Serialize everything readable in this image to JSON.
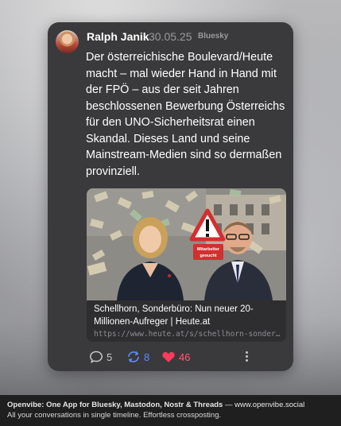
{
  "post": {
    "author": "Ralph Janik",
    "date": "30.05.25",
    "network": "Bluesky",
    "text": "Der österreichische Boulevard/Heute macht – mal wieder Hand in Hand mit der FPÖ – aus der seit Jahren beschlossenen Bewerbung Österreichs für den UNO-Sicherheitsrat einen Skandal. Dieses Land und seine Mainstream-Medien sind so dermaßen provinziell."
  },
  "link_card": {
    "title": "Schellhorn, Sonderbüro: Nun neuer 20-Millionen-Aufreger | Heute.at",
    "url": "https://www.heute.at/s/schellhorn-sonderbuero",
    "sign_text_1": "Mitarbeiter",
    "sign_text_2": "gesucht"
  },
  "actions": {
    "replies": "5",
    "reposts": "8",
    "likes": "46"
  },
  "footer": {
    "app_name": "Openvibe: One App for Bluesky, Mastodon, Nostr & Threads",
    "separator": " — ",
    "website": "www.openvibe.social",
    "tagline": "All your conversations in single timeline. Effortless crossposting."
  },
  "colors": {
    "card_bg": "#3a3a3c",
    "repost": "#5b8cff",
    "like": "#ff3b5c",
    "muted": "#9a9a9e"
  }
}
